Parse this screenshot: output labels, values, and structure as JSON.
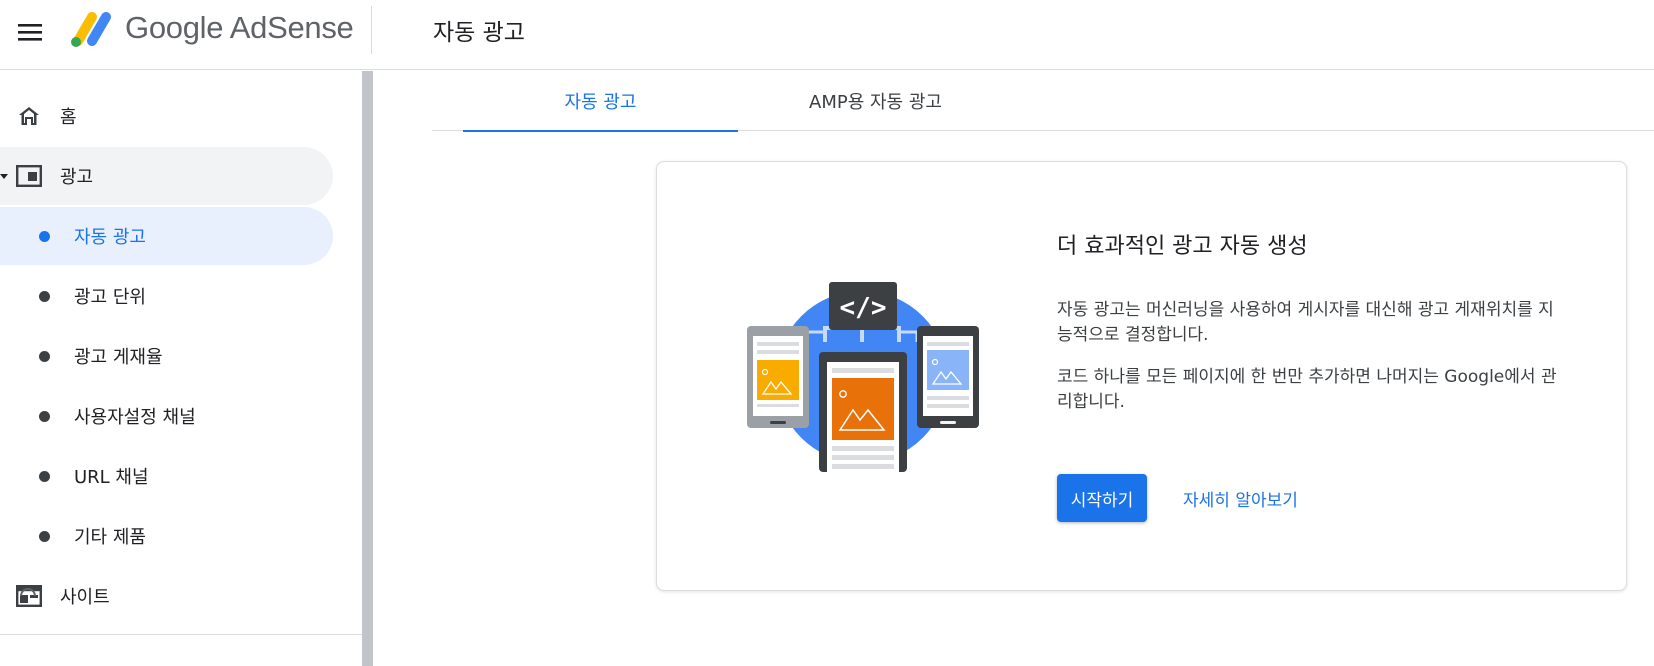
{
  "app": {
    "name": "Google AdSense",
    "page_title": "자동 광고"
  },
  "sidebar": {
    "items": [
      {
        "label": "홈",
        "icon": "home-icon"
      },
      {
        "label": "광고",
        "icon": "ads-icon"
      },
      {
        "label": "자동 광고"
      },
      {
        "label": "광고 단위"
      },
      {
        "label": "광고 게재율"
      },
      {
        "label": "사용자설정 채널"
      },
      {
        "label": "URL 채널"
      },
      {
        "label": "기타 제품"
      },
      {
        "label": "사이트",
        "icon": "sites-icon"
      }
    ]
  },
  "tabs": [
    {
      "label": "자동 광고",
      "active": true
    },
    {
      "label": "AMP용 자동 광고",
      "active": false
    }
  ],
  "card": {
    "heading": "더 효과적인 광고 자동 생성",
    "paragraph1": "자동 광고는 머신러닝을 사용하여 게시자를 대신해 광고 게재위치를 지능적으로 결정합니다.",
    "paragraph2": "코드 하나를 모든 페이지에 한 번만 추가하면 나머지는 Google에서 관리합니다.",
    "primary_button": "시작하기",
    "secondary_link": "자세히 알아보기",
    "illustration_code_label": "</>"
  },
  "colors": {
    "accent": "#1a73e8",
    "active_nav_bg": "#e8f0fe",
    "expanded_nav_bg": "#f1f3f4",
    "illustration_circle": "#4285f4",
    "illustration_orange": "#e8710a",
    "illustration_yellow": "#f9ab00",
    "illustration_lightblue": "#8ab4f8"
  }
}
